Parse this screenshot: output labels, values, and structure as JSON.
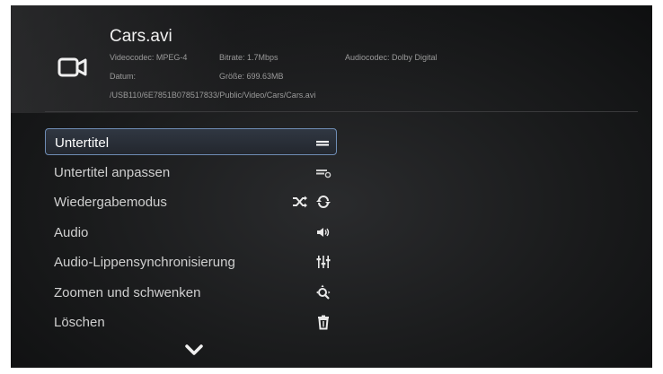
{
  "file": {
    "title": "Cars.avi",
    "icon": "video-camera-icon",
    "videocodec": "Videocodec: MPEG-4",
    "bitrate": "Bitrate: 1.7Mbps",
    "audiocodec": "Audiocodec: Dolby Digital",
    "date": "Datum:",
    "size": "Größe: 699.63MB",
    "path": "/USB110/6E7851B078517833/Public/Video/Cars/Cars.avi"
  },
  "menu": {
    "items": [
      {
        "label": "Untertitel",
        "icon": "subtitle-lines-icon",
        "selected": true
      },
      {
        "label": "Untertitel anpassen",
        "icon": "subtitle-adjust-icon"
      },
      {
        "label": "Wiedergabemodus",
        "icons": [
          "shuffle-icon",
          "repeat-icon"
        ]
      },
      {
        "label": "Audio",
        "icon": "speaker-icon"
      },
      {
        "label": "Audio-Lippensynchronisierung",
        "icon": "equalizer-icon"
      },
      {
        "label": "Zoomen und schwenken",
        "icon": "zoom-pan-icon"
      },
      {
        "label": "Löschen",
        "icon": "trash-icon"
      }
    ],
    "scroll_icon": "chevron-down-icon"
  },
  "colors": {
    "selection_border": "#6f8db5",
    "text": "#cfcfcf",
    "meta_text": "#9a9a9a"
  }
}
